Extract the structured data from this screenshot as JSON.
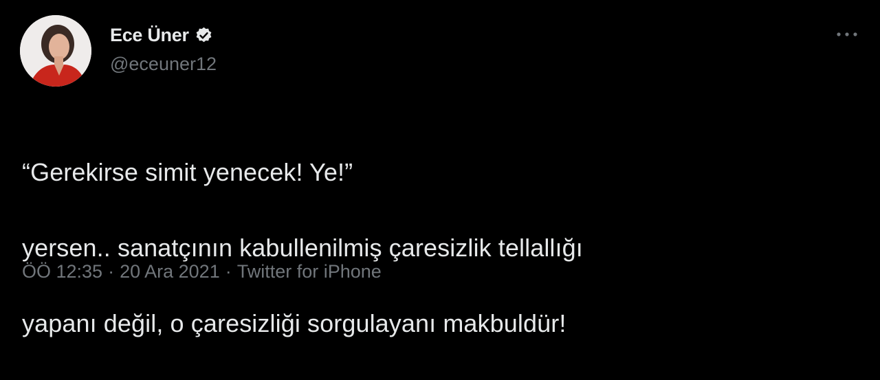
{
  "author": {
    "display_name": "Ece Üner",
    "handle": "@eceuner12",
    "verified": true,
    "avatar_icon": "profile-photo"
  },
  "tweet": {
    "lines": [
      "“Gerekirse simit yenecek! Ye!”",
      "yersen.. sanatçının kabullenilmiş çaresizlik tellallığı",
      "yapanı değil, o çaresizliği sorgulayanı makbuldür!"
    ]
  },
  "meta": {
    "time": "ÖÖ 12:35",
    "separator_1": "·",
    "date": "20 Ara 2021",
    "separator_2": "·",
    "source": "Twitter for iPhone"
  },
  "icons": {
    "verified_badge": "verified-badge-icon",
    "more": "more-options-icon"
  },
  "colors": {
    "background": "#000000",
    "text_primary": "#e7e9ea",
    "text_secondary": "#71767b",
    "verified_badge": "#e7e9ea"
  }
}
